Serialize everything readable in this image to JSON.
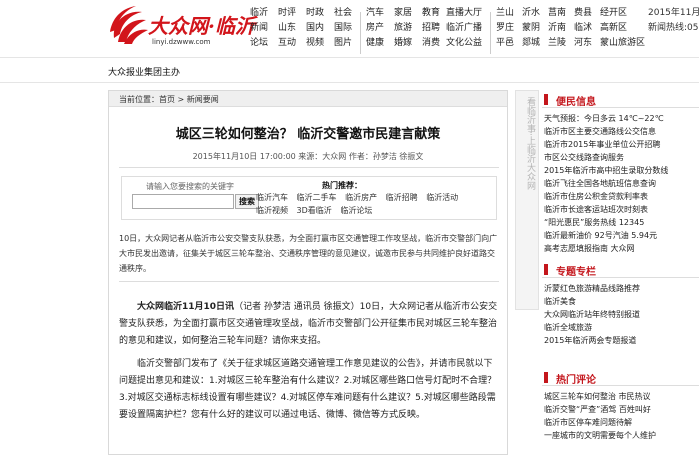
{
  "colors": {
    "brand_red": "#d2151b",
    "section_red": "#c4161c"
  },
  "logo": {
    "title": "大众网·临沂",
    "url": "linyi.dzwww.com"
  },
  "nav": {
    "col1": [
      "临沂",
      "新闻",
      "论坛"
    ],
    "col2": [
      "时评",
      "山东",
      "互动"
    ],
    "col3": [
      "时政",
      "国内",
      "视频"
    ],
    "col4": [
      "社会",
      "国际",
      "图片"
    ],
    "col5": [
      "汽车",
      "房产",
      "健康"
    ],
    "col6": [
      "家居",
      "旅游",
      "婚嫁"
    ],
    "col7": [
      "教育",
      "招聘",
      "消费"
    ],
    "col8": [
      "直播大厅",
      "临沂广播",
      "文化公益"
    ],
    "col9": [
      "兰山",
      "罗庄",
      "平邑"
    ],
    "col10": [
      "沂水",
      "蒙阴",
      "郯城"
    ],
    "col11": [
      "莒南",
      "沂南",
      "兰陵"
    ],
    "col12": [
      "费县",
      "临沭",
      "河东"
    ],
    "col13": [
      "经开区",
      "高新区",
      "蒙山旅游区"
    ]
  },
  "header_right": {
    "line1": "2015年11月",
    "line2": "新闻热线:053"
  },
  "bar": {
    "text": "大众报业集团主办"
  },
  "main": {
    "breadcrumb": "当前位置：首页 > 新闻要闻",
    "title": "城区三轮如何整治？ 临沂交警邀市民建言献策",
    "meta": "2015年11月10日  17:00:00  来源：大众网  作者：孙梦洁  徐振文",
    "search": {
      "label": "请输入您要搜索的关键字",
      "placeholder": "",
      "button": "搜索",
      "hot_title": "热门推荐：",
      "hot_rows": [
        [
          "临沂汽车",
          "临沂二手车",
          "临沂房产",
          "临沂招聘",
          "临沂活动"
        ],
        [
          "临沂视频",
          "3D看临沂",
          "临沂论坛"
        ]
      ]
    },
    "summary": "10日，大众网记者从临沂市公安交警支队获悉，为全面打赢市区交通管理工作攻坚战，临沂市交警部门向广大市民发出邀请，征集关于城区三轮车整治、交通秩序管理的意见建议，诚邀市民参与共同维护良好道路交通秩序。",
    "paragraphs": [
      {
        "lead": "大众网临沂11月10日讯",
        "text": "（记者 孙梦洁 通讯员 徐振文）10日，大众网记者从临沂市公安交警支队获悉，为全面打赢市区交通管理攻坚战，临沂市交警部门公开征集市民对城区三轮车整治的意见和建议，如何整治三轮车问题？请你来支招。"
      },
      {
        "lead": "",
        "text": "临沂交警部门发布了《关于征求城区道路交通管理工作意见建议的公告》，并请市民就以下问题提出意见和建议：1.对城区三轮车整治有什么建议？2.对城区哪些路口信号灯配时不合理？3.对城区交通标志标线设置有哪些建议？4.对城区停车难问题有什么建议？5.对城区哪些路段需要设置隔离护栏？您有什么好的建议可以通过电话、微博、微信等方式反映。"
      }
    ]
  },
  "vbanner": {
    "text": "看临沂事·上临沂大众网"
  },
  "side": {
    "sec1": {
      "title": "便民信息",
      "items": [
        "天气预报：今日多云 14℃~22℃",
        "临沂市区主要交通路线公交信息",
        "临沂市2015年事业单位公开招聘",
        "市区公交线路查询服务",
        "2015年临沂市高中招生录取分数线",
        "临沂飞往全国各地航班信息查询",
        "临沂市住房公积金贷款利率表",
        "临沂市长途客运站班次时刻表",
        "“阳光惠民”服务热线 12345",
        "临沂最新油价 92号汽油 5.94元",
        "高考志愿填报指南 大众网"
      ]
    },
    "sec2": {
      "title": "专题专栏",
      "items": [
        "沂蒙红色旅游精品线路推荐",
        "临沂美食",
        "大众网临沂站年终特别报道",
        "临沂全域旅游",
        "2015年临沂两会专题报道"
      ]
    },
    "sec3": {
      "title": "热门评论",
      "items": [
        "城区三轮车如何整治 市民热议",
        "临沂交警“严查”酒驾 百姓叫好",
        "临沂市区停车难问题待解",
        "一座城市的文明需要每个人维护"
      ]
    }
  }
}
